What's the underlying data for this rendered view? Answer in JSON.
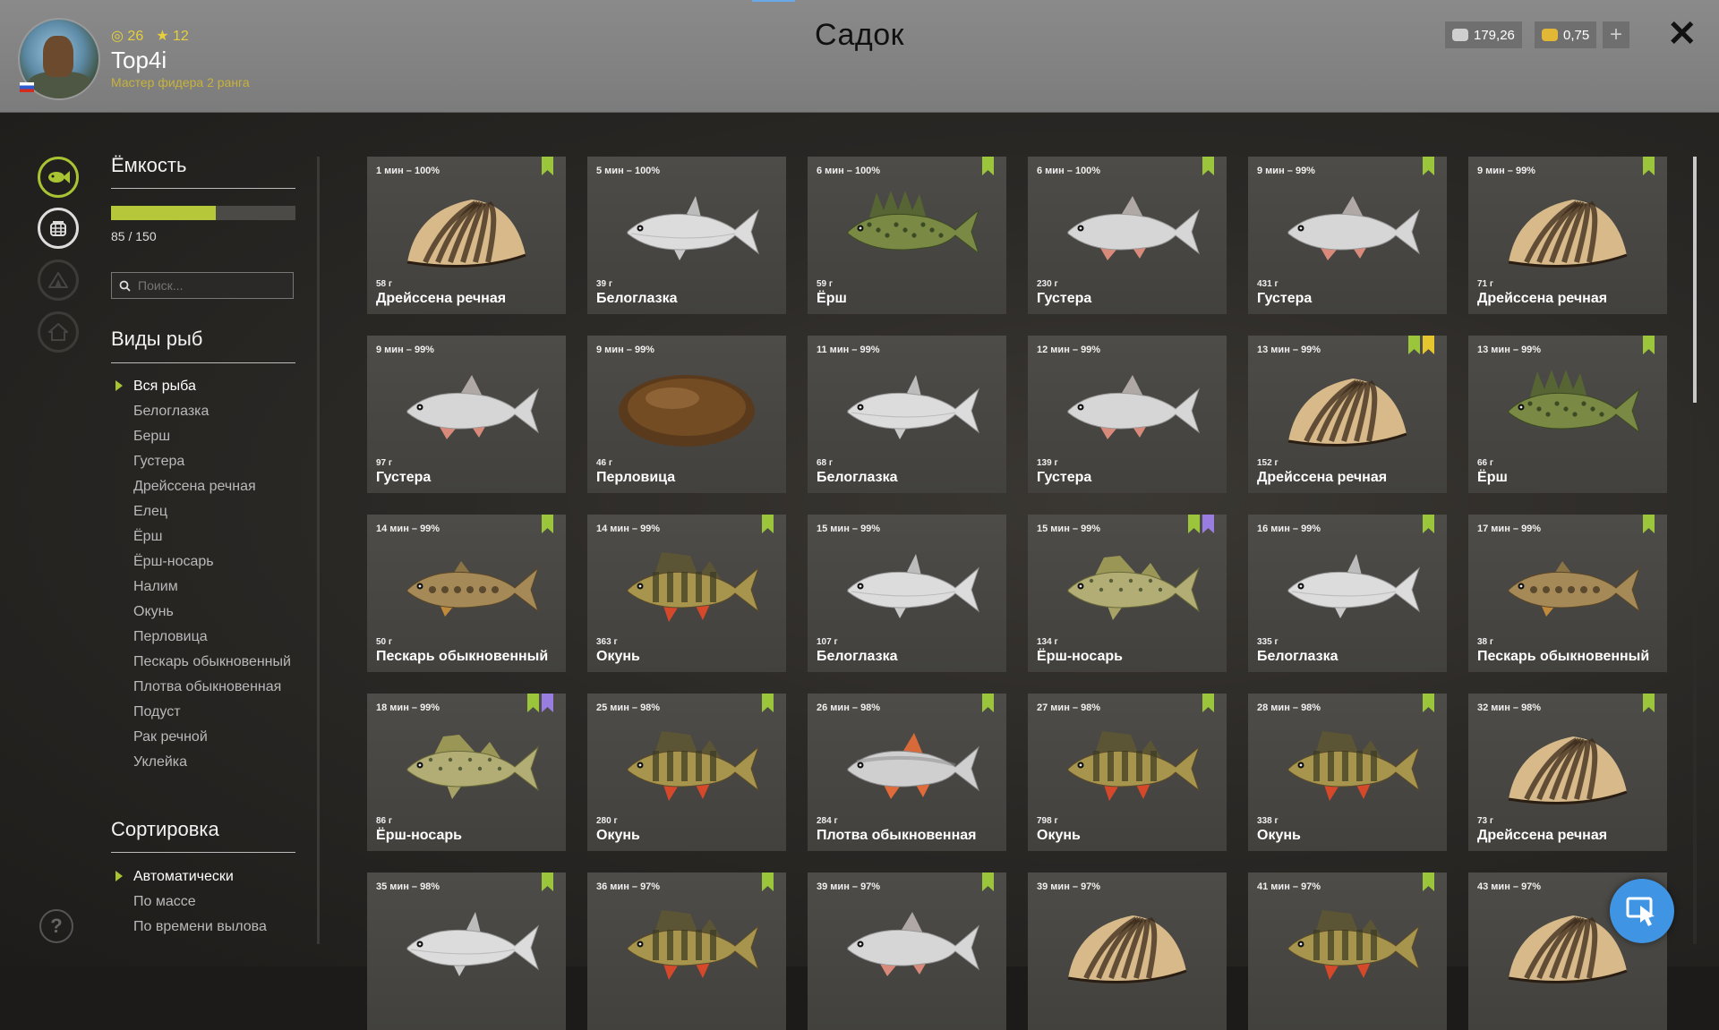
{
  "header": {
    "title": "Садок",
    "username": "Top4i",
    "rank": "Мастер фидера 2 ранга",
    "stat_level": "26",
    "stat_stars": "12",
    "silver": "179,26",
    "gold": "0,75",
    "add_label": "+",
    "close_label": "✕"
  },
  "sidebar": {
    "capacity_title": "Ёмкость",
    "capacity_value": "85 / 150",
    "capacity_fraction": 0.5667,
    "search_placeholder": "Поиск...",
    "species_title": "Виды рыб",
    "species": [
      "Вся рыба",
      "Белоглазка",
      "Берш",
      "Густера",
      "Дрейссена речная",
      "Елец",
      "Ёрш",
      "Ёрш-носарь",
      "Налим",
      "Окунь",
      "Перловица",
      "Пескарь обыкновенный",
      "Плотва обыкновенная",
      "Подуст",
      "Рак речной",
      "Уклейка"
    ],
    "species_active": 0,
    "sort_title": "Сортировка",
    "sort_options": [
      "Автоматически",
      "По массе",
      "По времени вылова"
    ],
    "sort_active": 0
  },
  "colors": {
    "accent_green": "#a9c433",
    "mark_green": "#9bc53a",
    "mark_yellow": "#e6c62e",
    "mark_purple": "#9a7de0",
    "button_blue": "#3f94e3"
  },
  "cards": [
    {
      "time": "1 мин – 100%",
      "weight": "58 г",
      "name": "Дрейссена речная",
      "kind": "mussel",
      "marks": [
        "green"
      ]
    },
    {
      "time": "5 мин – 100%",
      "weight": "39 г",
      "name": "Белоглазка",
      "kind": "silver",
      "marks": []
    },
    {
      "time": "6 мин – 100%",
      "weight": "59 г",
      "name": "Ёрш",
      "kind": "ruffe",
      "marks": [
        "green"
      ]
    },
    {
      "time": "6 мин – 100%",
      "weight": "230 г",
      "name": "Густера",
      "kind": "bream",
      "marks": [
        "green"
      ]
    },
    {
      "time": "9 мин – 99%",
      "weight": "431 г",
      "name": "Густера",
      "kind": "bream",
      "marks": [
        "green"
      ]
    },
    {
      "time": "9 мин – 99%",
      "weight": "71 г",
      "name": "Дрейссена речная",
      "kind": "mussel",
      "marks": [
        "green"
      ]
    },
    {
      "time": "9 мин – 99%",
      "weight": "97 г",
      "name": "Густера",
      "kind": "bream",
      "marks": []
    },
    {
      "time": "9 мин – 99%",
      "weight": "46 г",
      "name": "Перловица",
      "kind": "clam",
      "marks": []
    },
    {
      "time": "11 мин – 99%",
      "weight": "68 г",
      "name": "Белоглазка",
      "kind": "silver",
      "marks": []
    },
    {
      "time": "12 мин – 99%",
      "weight": "139 г",
      "name": "Густера",
      "kind": "bream",
      "marks": []
    },
    {
      "time": "13 мин – 99%",
      "weight": "152 г",
      "name": "Дрейссена речная",
      "kind": "mussel",
      "marks": [
        "green",
        "yellow"
      ]
    },
    {
      "time": "13 мин – 99%",
      "weight": "66 г",
      "name": "Ёрш",
      "kind": "ruffe",
      "marks": [
        "green"
      ]
    },
    {
      "time": "14 мин – 99%",
      "weight": "50 г",
      "name": "Пескарь обыкновенный",
      "kind": "gudgeon",
      "marks": [
        "green"
      ]
    },
    {
      "time": "14 мин – 99%",
      "weight": "363 г",
      "name": "Окунь",
      "kind": "perch",
      "marks": [
        "green"
      ]
    },
    {
      "time": "15 мин – 99%",
      "weight": "107 г",
      "name": "Белоглазка",
      "kind": "silver",
      "marks": []
    },
    {
      "time": "15 мин – 99%",
      "weight": "134 г",
      "name": "Ёрш-носарь",
      "kind": "nosar",
      "marks": [
        "green",
        "purple"
      ]
    },
    {
      "time": "16 мин – 99%",
      "weight": "335 г",
      "name": "Белоглазка",
      "kind": "silver",
      "marks": [
        "green"
      ]
    },
    {
      "time": "17 мин – 99%",
      "weight": "38 г",
      "name": "Пескарь обыкновенный",
      "kind": "gudgeon",
      "marks": [
        "green"
      ]
    },
    {
      "time": "18 мин – 99%",
      "weight": "86 г",
      "name": "Ёрш-носарь",
      "kind": "nosar",
      "marks": [
        "green",
        "purple"
      ]
    },
    {
      "time": "25 мин – 98%",
      "weight": "280 г",
      "name": "Окунь",
      "kind": "perch",
      "marks": [
        "green"
      ]
    },
    {
      "time": "26 мин – 98%",
      "weight": "284 г",
      "name": "Плотва обыкновенная",
      "kind": "roach",
      "marks": [
        "green"
      ]
    },
    {
      "time": "27 мин – 98%",
      "weight": "798 г",
      "name": "Окунь",
      "kind": "perch",
      "marks": [
        "green"
      ]
    },
    {
      "time": "28 мин – 98%",
      "weight": "338 г",
      "name": "Окунь",
      "kind": "perch",
      "marks": [
        "green"
      ]
    },
    {
      "time": "32 мин – 98%",
      "weight": "73 г",
      "name": "Дрейссена речная",
      "kind": "mussel",
      "marks": [
        "green"
      ]
    },
    {
      "time": "35 мин – 98%",
      "weight": "",
      "name": "",
      "kind": "silver",
      "marks": [
        "green"
      ]
    },
    {
      "time": "36 мин – 97%",
      "weight": "",
      "name": "",
      "kind": "perch",
      "marks": [
        "green"
      ]
    },
    {
      "time": "39 мин – 97%",
      "weight": "",
      "name": "",
      "kind": "bream",
      "marks": [
        "green"
      ]
    },
    {
      "time": "39 мин – 97%",
      "weight": "",
      "name": "",
      "kind": "mussel",
      "marks": []
    },
    {
      "time": "41 мин – 97%",
      "weight": "",
      "name": "",
      "kind": "perch",
      "marks": [
        "green"
      ]
    },
    {
      "time": "43 мин – 97%",
      "weight": "",
      "name": "",
      "kind": "mussel",
      "marks": []
    }
  ]
}
